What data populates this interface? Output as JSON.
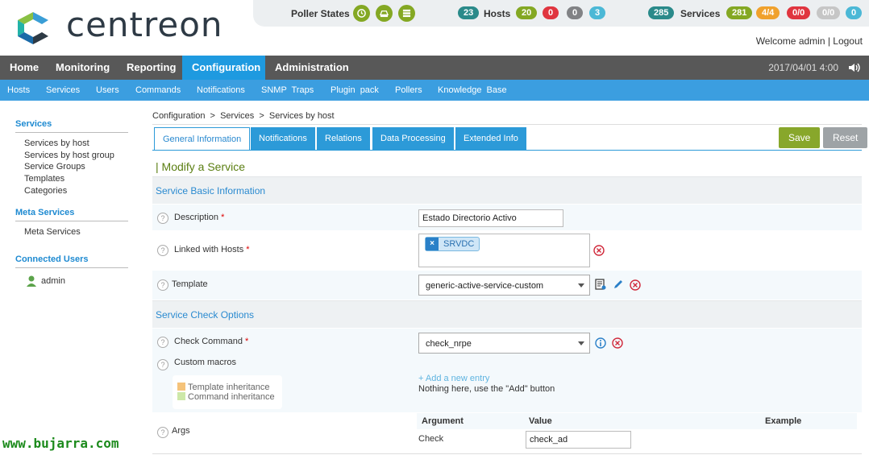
{
  "header": {
    "logo_text": "centreon",
    "poller_states_label": "Poller States",
    "hosts_label": "Hosts",
    "services_label": "Services",
    "host_counts": [
      "23",
      "20",
      "0",
      "0",
      "3"
    ],
    "service_counts": [
      "285",
      "281",
      "4/4",
      "0/0",
      "0/0",
      "0"
    ],
    "welcome": "Welcome admin | Logout"
  },
  "mainnav": {
    "items": [
      "Home",
      "Monitoring",
      "Reporting",
      "Configuration",
      "Administration"
    ],
    "datetime": "2017/04/01 4:00"
  },
  "subnav": {
    "items": [
      "Hosts",
      "Services",
      "Users",
      "Commands",
      "Notifications",
      "SNMP  Traps",
      "Plugin  pack",
      "Pollers",
      "Knowledge  Base"
    ]
  },
  "sidebar": {
    "services_title": "Services",
    "services_items": [
      "Services by host",
      "Services by host group",
      "Service Groups",
      "Templates",
      "Categories"
    ],
    "meta_title": "Meta Services",
    "meta_items": [
      "Meta Services"
    ],
    "users_title": "Connected Users",
    "users": [
      "admin"
    ]
  },
  "breadcrumb": "Configuration  >  Services  >  Services by host",
  "tabs": [
    "General Information",
    "Notifications",
    "Relations",
    "Data Processing",
    "Extended Info"
  ],
  "buttons": {
    "save": "Save",
    "reset": "Reset"
  },
  "form": {
    "title": "| Modify a Service",
    "section_basic": "Service Basic Information",
    "description_label": "Description",
    "description_value": "Estado Directorio Activo",
    "linked_hosts_label": "Linked with Hosts",
    "linked_host_tag": "SRVDC",
    "template_label": "Template",
    "template_value": "generic-active-service-custom",
    "section_check": "Service Check Options",
    "check_command_label": "Check Command",
    "check_command_value": "check_nrpe",
    "custom_macros_label": "Custom macros",
    "legend_template": "Template inheritance",
    "legend_command": "Command inheritance",
    "add_entry": "+ Add a new entry",
    "nothing_here": "Nothing here, use the \"Add\" button",
    "args_label": "Args",
    "args_headers": [
      "Argument",
      "Value",
      "Example"
    ],
    "args_argument": "Check",
    "args_value": "check_ad",
    "required_mark": "*"
  },
  "watermark": "www.bujarra.com",
  "colors": {
    "accent": "#1e9ae0",
    "ok": "#84a823",
    "critical": "#e0353f",
    "warning": "#f0a12c"
  }
}
